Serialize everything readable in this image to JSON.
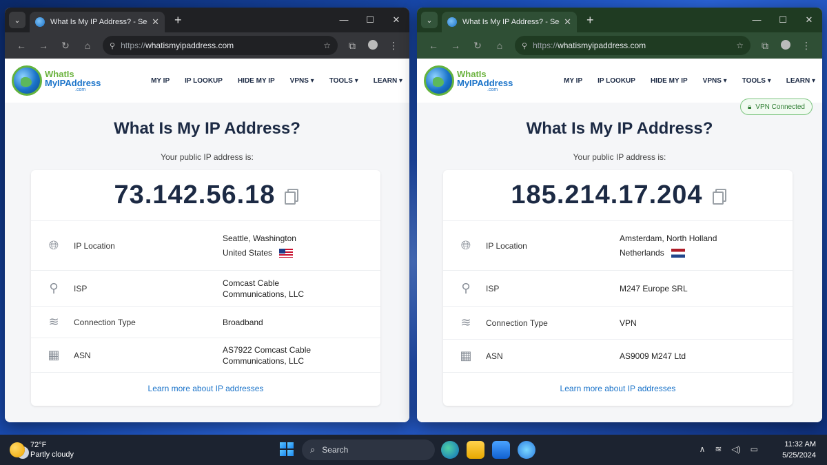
{
  "left": {
    "tab_title": "What Is My IP Address? - See Yo",
    "url_scheme": "https://",
    "url_host": "whatismyipaddress.com",
    "ip": "73.142.56.18",
    "location_line1": "Seattle, Washington",
    "location_line2": "United States",
    "isp_line1": "Comcast Cable",
    "isp_line2": "Communications, LLC",
    "connection_type": "Broadband",
    "asn_line1": "AS7922 Comcast Cable",
    "asn_line2": "Communications, LLC"
  },
  "right": {
    "tab_title": "What Is My IP Address? - See Yo",
    "url_scheme": "https://",
    "url_host": "whatismyipaddress.com",
    "vpn_badge": "VPN Connected",
    "ip": "185.214.17.204",
    "location_line1": "Amsterdam, North Holland",
    "location_line2": "Netherlands",
    "isp_line1": "M247 Europe SRL",
    "connection_type": "VPN",
    "asn_line1": "AS9009 M247 Ltd"
  },
  "site": {
    "logo_line1": "WhatIs",
    "logo_line2": "MyIPAddress",
    "logo_line3": ".com",
    "nav": [
      "MY IP",
      "IP LOOKUP",
      "HIDE MY IP",
      "VPNS ▾",
      "TOOLS ▾",
      "LEARN ▾"
    ],
    "headline": "What Is My IP Address?",
    "subtitle": "Your public IP address is:",
    "label_location": "IP Location",
    "label_isp": "ISP",
    "label_connection": "Connection Type",
    "label_asn": "ASN",
    "learn_link": "Learn more about IP addresses"
  },
  "taskbar": {
    "temp": "72°F",
    "weather": "Partly cloudy",
    "search_placeholder": "Search",
    "time": "11:32 AM",
    "date": "5/25/2024"
  }
}
